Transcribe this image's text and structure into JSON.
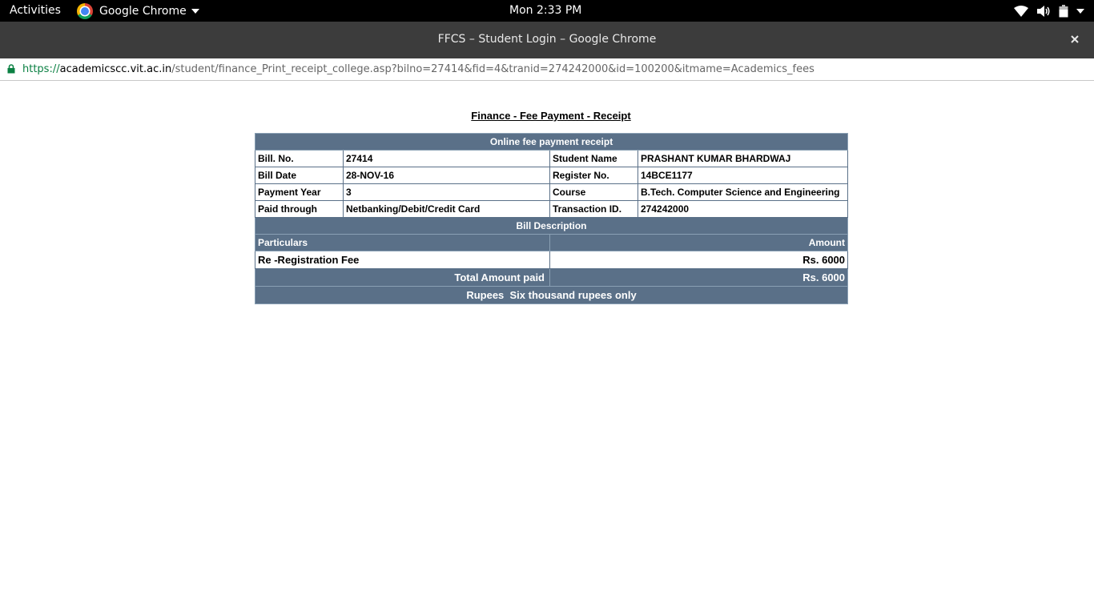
{
  "topbar": {
    "activities": "Activities",
    "app_name": "Google Chrome",
    "clock": "Mon  2:33 PM"
  },
  "window": {
    "title": "FFCS – Student Login – Google Chrome"
  },
  "urlbar": {
    "scheme": "https://",
    "host": "academicscc.vit.ac.in",
    "path": "/student/finance_Print_receipt_college.asp?bilno=27414&fid=4&tranid=274242000&id=100200&itmame=Academics_fees"
  },
  "receipt": {
    "page_title": "Finance - Fee Payment - Receipt",
    "header": "Online fee payment receipt",
    "fields": {
      "bill_no_label": "Bill. No.",
      "bill_no": "27414",
      "student_name_label": "Student Name",
      "student_name": "PRASHANT KUMAR BHARDWAJ",
      "bill_date_label": "Bill Date",
      "bill_date": "28-NOV-16",
      "register_no_label": "Register No.",
      "register_no": "14BCE1177",
      "payment_year_label": "Payment Year",
      "payment_year": "3",
      "course_label": "Course",
      "course": "B.Tech. Computer Science and Engineering",
      "paid_through_label": "Paid through",
      "paid_through": "Netbanking/Debit/Credit Card",
      "transaction_id_label": "Transaction ID.",
      "transaction_id": "274242000"
    },
    "bill_description_header": "Bill Description",
    "particulars_label": "Particulars",
    "amount_label": "Amount",
    "items": [
      {
        "particular": "Re -Registration Fee",
        "amount": "Rs. 6000"
      }
    ],
    "total_label": "Total Amount paid",
    "total_amount": "Rs. 6000",
    "amount_in_words": "Rupees  Six thousand rupees only"
  },
  "colors": {
    "table_header_bg": "#5a7088",
    "topbar_bg": "#000000",
    "titlebar_bg": "#3c3c3c",
    "url_scheme": "#0b8043"
  },
  "icons": [
    "chrome-logo-icon",
    "chevron-down-icon",
    "wifi-icon",
    "volume-icon",
    "battery-icon",
    "close-icon",
    "lock-icon"
  ]
}
